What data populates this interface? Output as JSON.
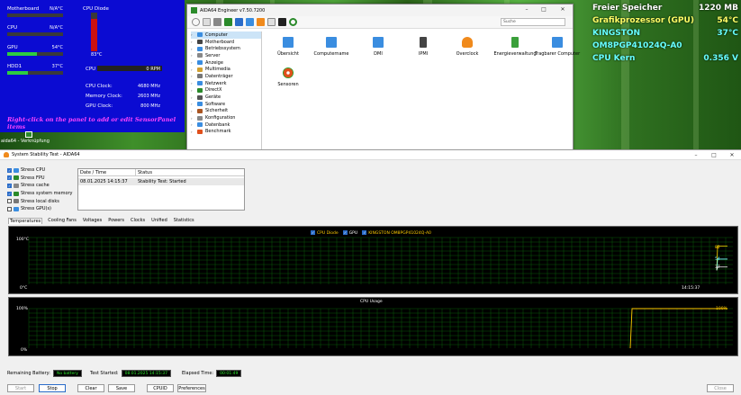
{
  "sensor_panel": {
    "motherboard": {
      "label": "Motherboard",
      "value": "N/A°C"
    },
    "cpu": {
      "label": "CPU",
      "value": "N/A°C"
    },
    "gpu": {
      "label": "GPU",
      "value": "54°C",
      "level": 0.54
    },
    "hdd": {
      "label": "HDD1",
      "value": "37°C",
      "level": 0.37
    },
    "cpu_diode": {
      "label": "CPU Diode",
      "value": "83°C",
      "level": 0.83
    },
    "cpu_fan": {
      "label": "CPU",
      "value": "0 RPM"
    },
    "clocks": [
      {
        "label": "CPU Clock:",
        "value": "4680 MHz"
      },
      {
        "label": "Memory Clock:",
        "value": "2603 MHz"
      },
      {
        "label": "GPU Clock:",
        "value": "800 MHz"
      }
    ],
    "hint": "Right-click on the panel to add or edit SensorPanel items"
  },
  "desktop_icon": {
    "label": "aida64 - Verknüpfung"
  },
  "osd": [
    {
      "label": "Freier Speicher",
      "value": "1220 MB",
      "color": "#ffffff"
    },
    {
      "label": "Grafikprozessor (GPU)",
      "value": "54°C",
      "color": "#ffff66"
    },
    {
      "label": "KINGSTON OM8PGP41024Q-A0",
      "value": "37°C",
      "color": "#66ffff"
    },
    {
      "label": "CPU Kern",
      "value": "0.356 V",
      "color": "#66ffff"
    }
  ],
  "aida_window": {
    "title": "AIDA64 Engineer v7.50.7200",
    "search_placeholder": "Suche",
    "tree": [
      "Computer",
      "Motherboard",
      "Betriebssystem",
      "Server",
      "Anzeige",
      "Multimedia",
      "Datenträger",
      "Netzwerk",
      "DirectX",
      "Geräte",
      "Software",
      "Sicherheit",
      "Konfiguration",
      "Datenbank",
      "Benchmark"
    ],
    "items": [
      {
        "label": "Übersicht",
        "color": "#3a8de0"
      },
      {
        "label": "Computername",
        "color": "#3a8de0"
      },
      {
        "label": "DMI",
        "color": "#3a8de0"
      },
      {
        "label": "IPMI",
        "color": "#444"
      },
      {
        "label": "Overclock",
        "color": "#f08a1c"
      },
      {
        "label": "Energieverwaltung",
        "color": "#3aa03a"
      },
      {
        "label": "Tragbarer Computer",
        "color": "#3a8de0"
      },
      {
        "label": "Sensoren",
        "color": "#e0501c"
      }
    ]
  },
  "sst": {
    "title": "System Stability Test - AIDA64",
    "options": [
      {
        "label": "Stress CPU",
        "checked": true
      },
      {
        "label": "Stress FPU",
        "checked": true
      },
      {
        "label": "Stress cache",
        "checked": true
      },
      {
        "label": "Stress system memory",
        "checked": true
      },
      {
        "label": "Stress local disks",
        "checked": false
      },
      {
        "label": "Stress GPU(s)",
        "checked": false
      }
    ],
    "log_headers": [
      "Date / Time",
      "Status"
    ],
    "log_rows": [
      {
        "time": "08.01.2025 14:15:37",
        "status": "Stability Test: Started"
      }
    ],
    "tabs": [
      "Temperatures",
      "Cooling Fans",
      "Voltages",
      "Powers",
      "Clocks",
      "Unified",
      "Statistics"
    ],
    "temp_chart": {
      "y_top": "100°C",
      "y_bottom": "0°C",
      "legend": [
        {
          "label": "CPU Diode",
          "color": "#ffcc00"
        },
        {
          "label": "GPU",
          "color": "#ffffff"
        },
        {
          "label": "KINGSTON OM8PGP41024Q-A0",
          "color": "#ffcc00"
        }
      ],
      "end_values": [
        "82",
        "54",
        "37"
      ],
      "time_label": "14:15:37"
    },
    "cpu_chart": {
      "title": "CPU Usage",
      "y_top": "100%",
      "y_bottom": "0%",
      "end_value": "100%"
    },
    "status": {
      "battery_label": "Remaining Battery:",
      "battery_value": "No battery",
      "started_label": "Test Started:",
      "started_value": "08.01.2025 14:15:37",
      "elapsed_label": "Elapsed Time:",
      "elapsed_value": "00:01:49"
    },
    "buttons": {
      "start": "Start",
      "stop": "Stop",
      "clear": "Clear",
      "save": "Save",
      "cpuid": "CPUID",
      "prefs": "Preferences",
      "close": "Close"
    }
  },
  "chart_data": [
    {
      "type": "line",
      "title": "",
      "ylim": [
        0,
        100
      ],
      "ylabel": "°C",
      "series": [
        {
          "name": "CPU Diode",
          "values": [
            82
          ]
        },
        {
          "name": "GPU",
          "values": [
            54
          ]
        },
        {
          "name": "KINGSTON OM8PGP41024Q-A0",
          "values": [
            37
          ]
        }
      ],
      "x": [
        "14:15:37"
      ]
    },
    {
      "type": "line",
      "title": "CPU Usage",
      "ylim": [
        0,
        100
      ],
      "series": [
        {
          "name": "",
          "values": [
            0,
            100
          ]
        }
      ]
    }
  ]
}
